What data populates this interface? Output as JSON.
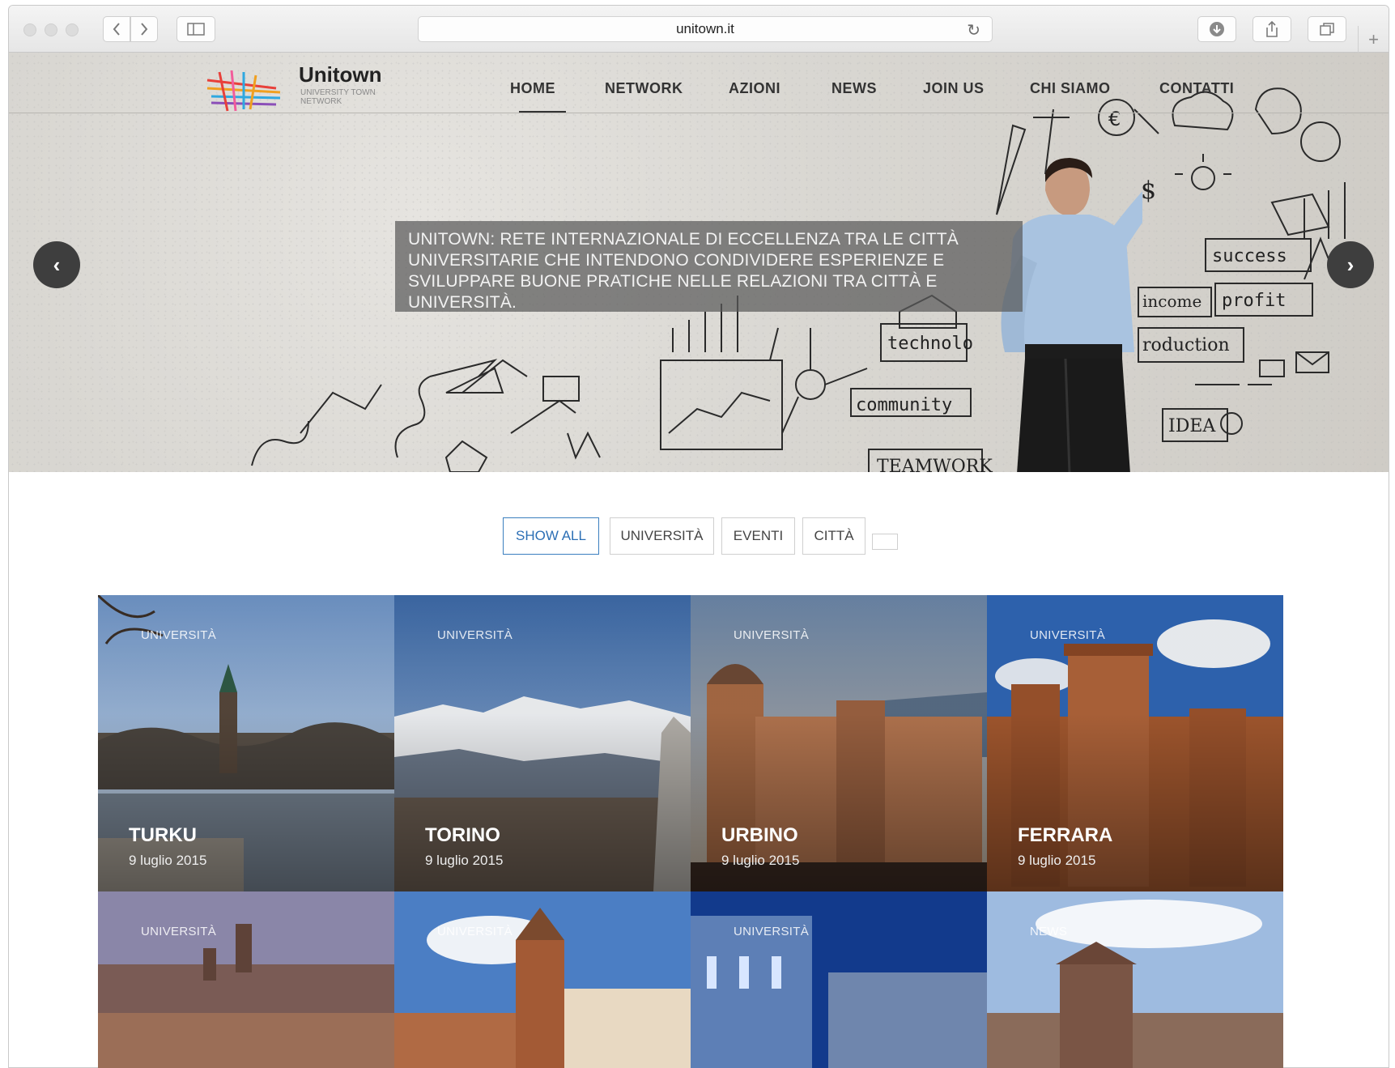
{
  "browser": {
    "url": "unitown.it",
    "back_icon": "chevron-left",
    "forward_icon": "chevron-right",
    "sidebar_icon": "sidebar",
    "reload_icon": "reload",
    "download_icon": "download",
    "share_icon": "share",
    "tabs_icon": "tabs",
    "newtab_icon": "plus"
  },
  "site": {
    "logo_title": "Unitown",
    "logo_subtitle": "UNIVERSITY TOWN NETWORK",
    "nav": [
      "HOME",
      "NETWORK",
      "AZIONI",
      "NEWS",
      "JOIN US",
      "CHI SIAMO",
      "CONTATTI"
    ],
    "nav_active": "HOME"
  },
  "hero": {
    "caption": "UNITOWN: RETE INTERNAZIONALE DI ECCELLENZA TRA LE CITTÀ UNIVERSITARIE CHE INTENDONO CONDIVIDERE ESPERIENZE E SVILUPPARE BUONE PRATICHE NELLE RELAZIONI TRA CITTÀ E UNIVERSITÀ.",
    "prev_icon": "chevron-left",
    "next_icon": "chevron-right",
    "sketch_words": [
      "success",
      "profit",
      "income",
      "production",
      "technology",
      "community",
      "TEAMWORK",
      "IDEA"
    ]
  },
  "filters": {
    "items": [
      "SHOW ALL",
      "UNIVERSITÀ",
      "EVENTI",
      "CITTÀ"
    ],
    "active": "SHOW ALL"
  },
  "tiles": [
    {
      "category": "UNIVERSITÀ",
      "title": "TURKU",
      "date": "9 luglio 2015"
    },
    {
      "category": "UNIVERSITÀ",
      "title": "TORINO",
      "date": "9 luglio 2015"
    },
    {
      "category": "UNIVERSITÀ",
      "title": "URBINO",
      "date": "9 luglio 2015"
    },
    {
      "category": "UNIVERSITÀ",
      "title": "FERRARA",
      "date": "9 luglio 2015"
    },
    {
      "category": "UNIVERSITÀ",
      "title": "",
      "date": ""
    },
    {
      "category": "UNIVERSITÀ",
      "title": "",
      "date": ""
    },
    {
      "category": "UNIVERSITÀ",
      "title": "",
      "date": ""
    },
    {
      "category": "NEWS",
      "title": "",
      "date": ""
    }
  ]
}
